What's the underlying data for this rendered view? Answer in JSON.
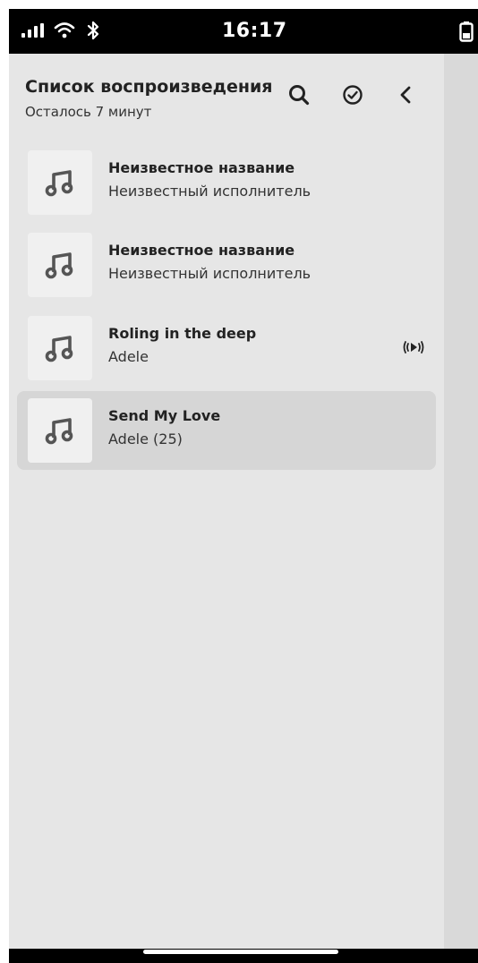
{
  "status_bar": {
    "time": "16:17",
    "signal_icon": "signal-bars-icon",
    "wifi_icon": "wifi-icon",
    "bluetooth_icon": "bluetooth-icon",
    "battery_icon": "battery-icon"
  },
  "header": {
    "title": "Список воспроизведения",
    "subtitle": "Осталось 7 минут",
    "search_icon": "search-icon",
    "select_icon": "check-circle-icon",
    "back_icon": "chevron-left-icon"
  },
  "tracks": [
    {
      "title": "Неизвестное название",
      "artist": "Неизвестный исполнитель",
      "cover_icon": "music-note-icon",
      "playing": false,
      "selected": false
    },
    {
      "title": "Неизвестное название",
      "artist": "Неизвестный исполнитель",
      "cover_icon": "music-note-icon",
      "playing": false,
      "selected": false
    },
    {
      "title": "Roling in the deep",
      "artist": "Adele",
      "cover_icon": "music-note-icon",
      "playing": true,
      "selected": false
    },
    {
      "title": "Send My Love",
      "artist": "Adele (25)",
      "cover_icon": "music-note-icon",
      "playing": false,
      "selected": true
    }
  ],
  "colors": {
    "background": "#e6e6e6",
    "selected_row": "#d6d6d6",
    "cover_bg": "#f0f0f0",
    "icon": "#555555"
  }
}
